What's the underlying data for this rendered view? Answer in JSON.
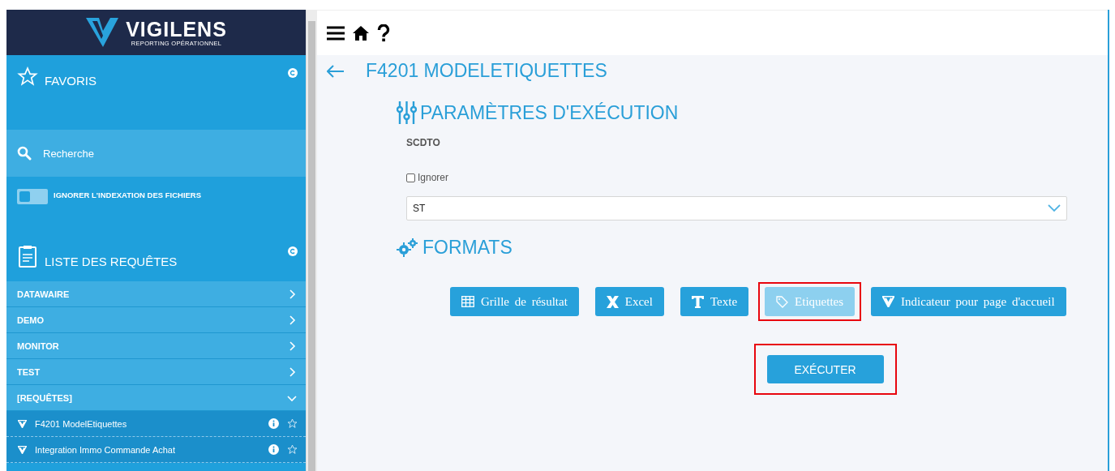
{
  "sidebar": {
    "logo": {
      "name": "VIGILENS",
      "tagline": "REPORTING OPÉRATIONNEL"
    },
    "favorites": {
      "title": "FAVORIS"
    },
    "search": {
      "placeholder": "Recherche"
    },
    "index_toggle": {
      "label": "IGNORER L'INDEXATION DES FICHIERS",
      "on": false
    },
    "requests": {
      "title": "LISTE DES REQUÊTES",
      "categories": [
        {
          "label": "DATAWAIRE",
          "expanded": false
        },
        {
          "label": "DEMO",
          "expanded": false
        },
        {
          "label": "MONITOR",
          "expanded": false
        },
        {
          "label": "TEST",
          "expanded": false
        },
        {
          "label": "[REQUÊTES]",
          "expanded": true,
          "children": [
            {
              "label": "F4201 ModelEtiquettes",
              "favorite": false
            },
            {
              "label": "Integration Immo Commande Achat",
              "favorite": false
            }
          ]
        }
      ]
    }
  },
  "page": {
    "title": "F4201 MODELETIQUETTES",
    "parameters": {
      "title": "PARAMÈTRES D'EXÉCUTION",
      "field_label": "SCDTO",
      "ignore": {
        "label": "Ignorer",
        "checked": false
      },
      "select_value": "ST"
    },
    "formats": {
      "title": "FORMATS",
      "buttons": [
        {
          "kind": "grid",
          "label": "Grille de résultat",
          "selected": false,
          "highlighted": false
        },
        {
          "kind": "excel",
          "label": "Excel",
          "selected": false,
          "highlighted": false
        },
        {
          "kind": "text",
          "label": "Texte",
          "selected": false,
          "highlighted": false
        },
        {
          "kind": "labels",
          "label": "Etiquettes",
          "selected": true,
          "highlighted": true
        },
        {
          "kind": "indicator",
          "label": "Indicateur pour page d'accueil",
          "selected": false,
          "highlighted": false
        }
      ]
    },
    "execute": {
      "label": "EXÉCUTER",
      "highlighted": true
    }
  }
}
